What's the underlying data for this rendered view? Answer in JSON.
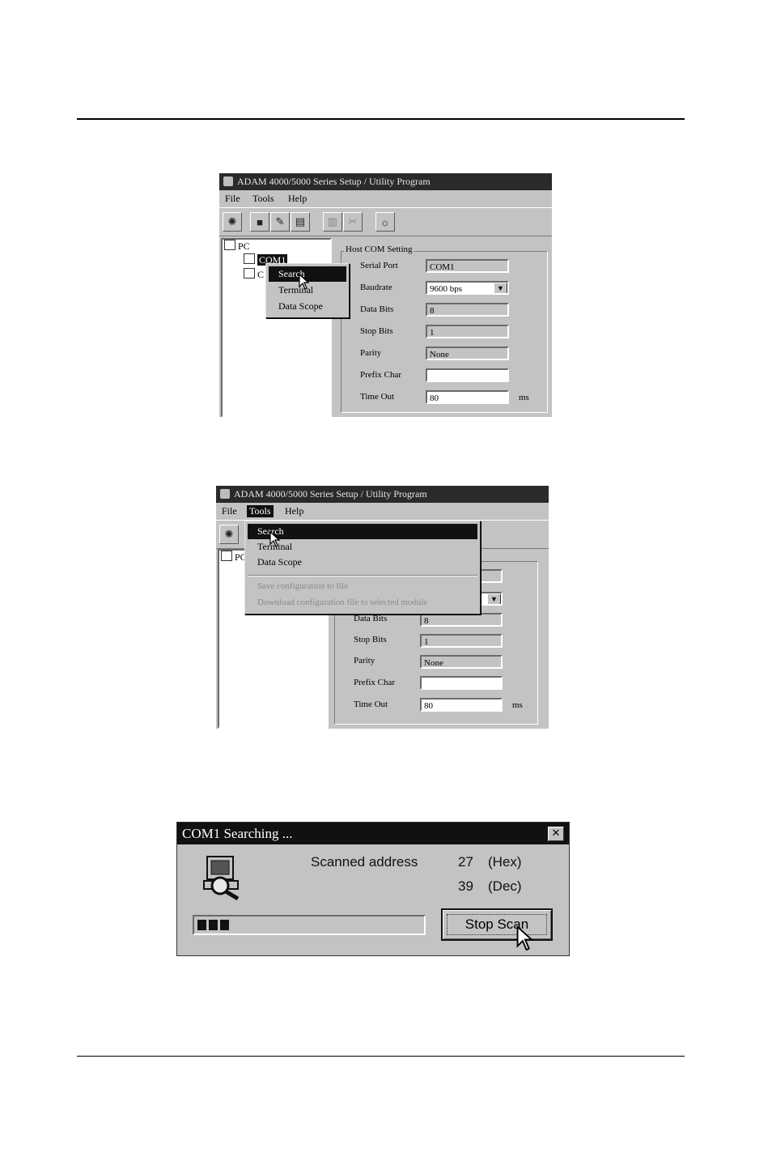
{
  "screenshot1": {
    "title": "ADAM 4000/5000 Series Setup / Utility Program",
    "menu": [
      "File",
      "Tools",
      "Help"
    ],
    "tree_root": "PC",
    "tree_com1": "COM1",
    "tree_com2": "C",
    "popup_items": [
      "Search",
      "Terminal",
      "Data Scope"
    ],
    "group_title": "Host COM Setting",
    "settings": [
      {
        "label": "Serial Port",
        "value": "COM1"
      },
      {
        "label": "Baudrate",
        "value": "9600 bps"
      },
      {
        "label": "Data Bits",
        "value": "8"
      },
      {
        "label": "Stop Bits",
        "value": "1"
      },
      {
        "label": "Parity",
        "value": "None"
      },
      {
        "label": "Prefix Char",
        "value": ""
      },
      {
        "label": "Time Out",
        "value": "80"
      }
    ],
    "unit": "ms"
  },
  "screenshot2": {
    "title": "ADAM 4000/5000 Series Setup / Utility Program",
    "menu": [
      "File",
      "Tools",
      "Help"
    ],
    "tree_root": "PC",
    "dropdown_items": [
      "Search",
      "Terminal",
      "Data Scope"
    ],
    "dropdown_disabled": [
      "Save configuration to file",
      "Download configuration file to selected module"
    ],
    "settings": [
      {
        "label": "Data Bits",
        "value": "8"
      },
      {
        "label": "Stop Bits",
        "value": "1"
      },
      {
        "label": "Parity",
        "value": "None"
      },
      {
        "label": "Prefix Char",
        "value": ""
      },
      {
        "label": "Time Out",
        "value": "80"
      }
    ],
    "unit": "ms"
  },
  "dialog": {
    "title": "COM1 Searching ...",
    "close_glyph": "✕",
    "scanned_label": "Scanned address",
    "hex_value": "27",
    "hex_label": "(Hex)",
    "dec_value": "39",
    "dec_label": "(Dec)",
    "progress_blocks": 3,
    "stop_button": "Stop Scan"
  }
}
